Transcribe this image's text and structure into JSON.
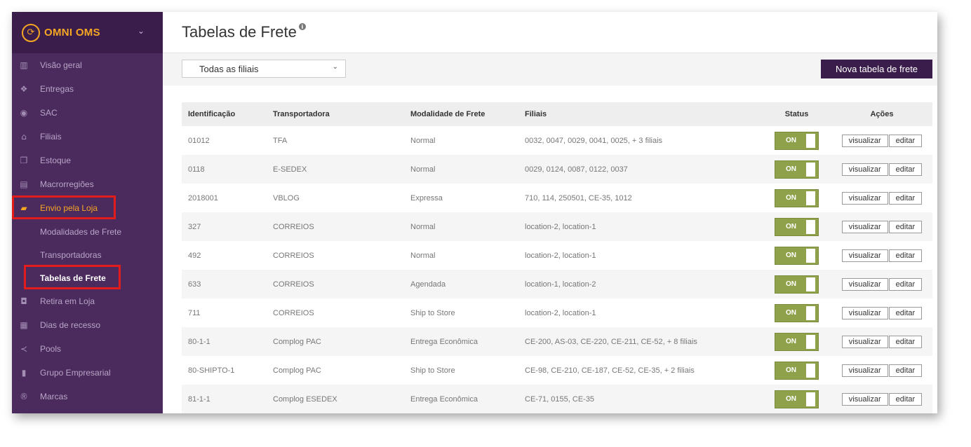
{
  "brand": {
    "name": "OMNI OMS",
    "logo_icon": "cart-logo-icon",
    "chevron": "⌄"
  },
  "sidebar": {
    "items": [
      {
        "label": "Visão geral",
        "icon": "bar-chart-icon",
        "glyph": "▥"
      },
      {
        "label": "Entregas",
        "icon": "dropbox-icon",
        "glyph": "❖"
      },
      {
        "label": "SAC",
        "icon": "user-circle-icon",
        "glyph": "◉"
      },
      {
        "label": "Filiais",
        "icon": "home-icon",
        "glyph": "⌂"
      },
      {
        "label": "Estoque",
        "icon": "cubes-icon",
        "glyph": "❒"
      },
      {
        "label": "Macrorregiões",
        "icon": "map-icon",
        "glyph": "▤"
      },
      {
        "label": "Envio pela Loja",
        "icon": "truck-icon",
        "glyph": "▰"
      }
    ],
    "subitems": [
      {
        "label": "Modalidades de Frete"
      },
      {
        "label": "Transportadoras"
      },
      {
        "label": "Tabelas de Frete"
      }
    ],
    "items_after": [
      {
        "label": "Retira em Loja",
        "icon": "shopping-bag-icon",
        "glyph": "◘"
      },
      {
        "label": "Dias de recesso",
        "icon": "calendar-icon",
        "glyph": "▦"
      },
      {
        "label": "Pools",
        "icon": "share-icon",
        "glyph": "≺"
      },
      {
        "label": "Grupo Empresarial",
        "icon": "building-icon",
        "glyph": "▮"
      },
      {
        "label": "Marcas",
        "icon": "registered-icon",
        "glyph": "®"
      }
    ]
  },
  "header": {
    "title": "Tabelas de Frete",
    "info_icon": "i"
  },
  "filter": {
    "selected": "Todas as filiais",
    "chevron": "⌄"
  },
  "toolbar": {
    "new_label": "Nova tabela de frete"
  },
  "table": {
    "headers": {
      "id": "Identificação",
      "carrier": "Transportadora",
      "mode": "Modalidade de Frete",
      "branches": "Filiais",
      "status": "Status",
      "actions": "Ações"
    },
    "view_label": "visualizar",
    "edit_label": "editar",
    "status_label": "ON",
    "rows": [
      {
        "id": "01012",
        "carrier": "TFA",
        "mode": "Normal",
        "branches": "0032, 0047, 0029, 0041, 0025, + 3 filiais"
      },
      {
        "id": "0118",
        "carrier": "E-SEDEX",
        "mode": "Normal",
        "branches": "0029, 0124, 0087, 0122, 0037"
      },
      {
        "id": "2018001",
        "carrier": "VBLOG",
        "mode": "Expressa",
        "branches": "710, 114, 250501, CE-35, 1012"
      },
      {
        "id": "327",
        "carrier": "CORREIOS",
        "mode": "Normal",
        "branches": "location-2, location-1"
      },
      {
        "id": "492",
        "carrier": "CORREIOS",
        "mode": "Normal",
        "branches": "location-2, location-1"
      },
      {
        "id": "633",
        "carrier": "CORREIOS",
        "mode": "Agendada",
        "branches": "location-1, location-2"
      },
      {
        "id": "711",
        "carrier": "CORREIOS",
        "mode": "Ship to Store",
        "branches": "location-2, location-1"
      },
      {
        "id": "80-1-1",
        "carrier": "Complog PAC",
        "mode": "Entrega Econômica",
        "branches": "CE-200, AS-03, CE-220, CE-211, CE-52, + 8 filiais"
      },
      {
        "id": "80-SHIPTO-1",
        "carrier": "Complog PAC",
        "mode": "Ship to Store",
        "branches": "CE-98, CE-210, CE-187, CE-52, CE-35, + 2 filiais"
      },
      {
        "id": "81-1-1",
        "carrier": "Complog ESEDEX",
        "mode": "Entrega Econômica",
        "branches": "CE-71, 0155, CE-35"
      }
    ]
  },
  "colors": {
    "sidebar": "#4b2a5e",
    "brand_bar": "#3a1d4b",
    "accent": "#f5a623",
    "toggle_on": "#8fa14b",
    "highlight_box": "#e21b1b"
  }
}
